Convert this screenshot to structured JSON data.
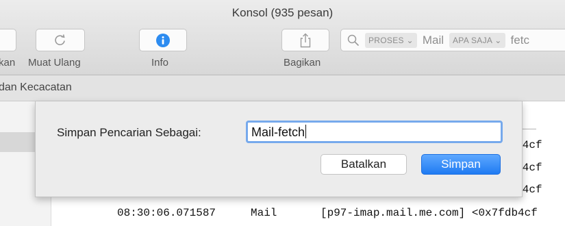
{
  "window": {
    "title": "Konsol (935 pesan)"
  },
  "toolbar": {
    "partial_left_label": "kan",
    "reload_label": "Muat Ulang",
    "info_label": "Info",
    "share_label": "Bagikan"
  },
  "search": {
    "token_process": "PROSES",
    "term_1": "Mail",
    "token_any": "APA SAJA",
    "term_2": "fetc"
  },
  "category_bar": {
    "label": "dan Kecacatan"
  },
  "log": {
    "fragments": [
      "fdb4cf",
      "fdb4cf",
      "fdb4cf",
      "fdb4cf"
    ],
    "row_time": "08:30:06.071587",
    "row_process": "Mail",
    "row_message": "[p97-imap.mail.me.com] <0x7fdb4cf"
  },
  "dialog": {
    "prompt": "Simpan Pencarian Sebagai:",
    "name_value": "Mail-fetch",
    "cancel_label": "Batalkan",
    "save_label": "Simpan"
  },
  "colors": {
    "accent": "#1f7bf2",
    "focus_ring": "#76a9ec",
    "info_icon": "#2d8cf0"
  }
}
